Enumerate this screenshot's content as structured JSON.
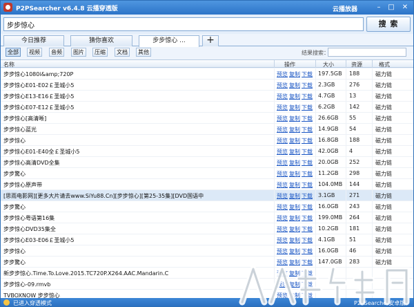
{
  "window": {
    "title": "P2PSearcher v6.4.8 云播穿透版",
    "cloud_player": "云播放器",
    "min": "–",
    "max": "□",
    "close": "✕"
  },
  "search": {
    "value": "步步惊心",
    "button": "搜 索"
  },
  "tabs": [
    "今日推荐",
    "猜你喜欢",
    "步步惊心 ...",
    "+"
  ],
  "filters": {
    "items": [
      "全部",
      "视频",
      "音频",
      "图片",
      "压缩",
      "文档",
      "其他"
    ],
    "active": "全部",
    "result_search_label": "结果搜索："
  },
  "table": {
    "headers": {
      "name": "名称",
      "action": "操作",
      "size": "大小",
      "sources": "资源",
      "format": "格式"
    },
    "action_labels": {
      "preview": "预览",
      "copy": "复制",
      "download": "下载"
    },
    "rows": [
      {
        "name": "步步惊心1080i&amp;720P",
        "size": "197.5GB",
        "sources": "188",
        "format": "磁力链"
      },
      {
        "name": "步步惊心E01-E02￡圣城小5",
        "size": "2.3GB",
        "sources": "276",
        "format": "磁力链"
      },
      {
        "name": "步步惊心E13-E16￡圣城小5",
        "size": "4.7GB",
        "sources": "13",
        "format": "磁力链"
      },
      {
        "name": "步步惊心E07-E12￡圣城小5",
        "size": "6.2GB",
        "sources": "142",
        "format": "磁力链"
      },
      {
        "name": "步步惊心[高清晰]",
        "size": "26.6GB",
        "sources": "55",
        "format": "磁力链"
      },
      {
        "name": "步步惊心蓝光",
        "size": "14.9GB",
        "sources": "54",
        "format": "磁力链"
      },
      {
        "name": "步步惊心",
        "size": "16.8GB",
        "sources": "188",
        "format": "磁力链"
      },
      {
        "name": "步步惊心E01-E40全￡圣城小5",
        "size": "42.0GB",
        "sources": "4",
        "format": "磁力链"
      },
      {
        "name": "步步惊心高清DVD全集",
        "size": "20.0GB",
        "sources": "252",
        "format": "磁力链"
      },
      {
        "name": "步步驚心",
        "size": "11.2GB",
        "sources": "298",
        "format": "磁力链"
      },
      {
        "name": "步步惊心原声带",
        "size": "104.0MB",
        "sources": "144",
        "format": "磁力链"
      },
      {
        "name": "[思雨电影网][更多大片请去www.SiYu88.Cn][步步惊心][第25-35集][DVD国语中",
        "size": "3.1GB",
        "sources": "271",
        "format": "磁力链"
      },
      {
        "name": "步步驚心",
        "size": "16.0GB",
        "sources": "243",
        "format": "磁力链"
      },
      {
        "name": "步步惊心粤语第16集",
        "size": "199.0MB",
        "sources": "264",
        "format": "磁力链"
      },
      {
        "name": "步步惊心DVD35集全",
        "size": "10.2GB",
        "sources": "181",
        "format": "磁力链"
      },
      {
        "name": "步步惊心E03-E06￡圣城小5",
        "size": "4.1GB",
        "sources": "51",
        "format": "磁力链"
      },
      {
        "name": "步步惊心",
        "size": "16.0GB",
        "sources": "46",
        "format": "磁力链"
      },
      {
        "name": "步步驚心",
        "size": "147.0GB",
        "sources": "283",
        "format": "磁力链"
      },
      {
        "name": "新步步惊心.Time.To.Love.2015.TC720P.X264.AAC.Mandarin.C",
        "size": "",
        "sources": "",
        "format": ""
      },
      {
        "name": "步步惊心-09.rmvb",
        "size": "",
        "sources": "",
        "format": ""
      },
      {
        "name": "TVBOXNOW 步步惊心",
        "size": "",
        "sources": "",
        "format": ""
      }
    ]
  },
  "status": {
    "text": "已进入穿透模式",
    "edition": "P2PSearcher安卓版"
  },
  "colors": {
    "titlebar": "#2c74c8",
    "link": "#1a56c4",
    "selected_row": "#dce9f7"
  }
}
